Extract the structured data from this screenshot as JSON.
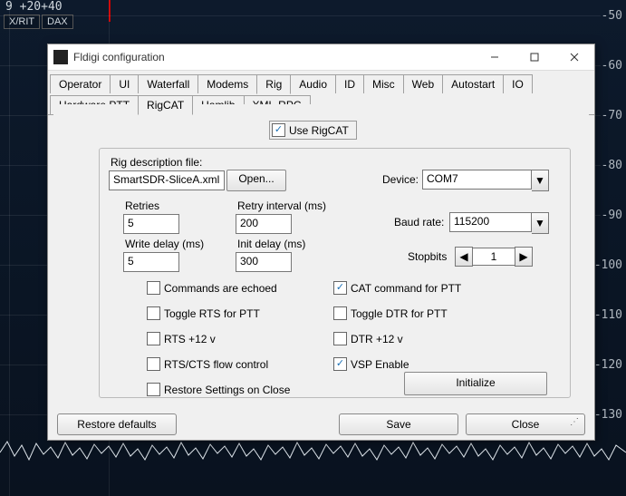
{
  "bg": {
    "top_scale": "9 +20+40",
    "top_buttons": [
      "X/RIT",
      "DAX"
    ],
    "db_labels": [
      "-50",
      "-60",
      "-70",
      "-80",
      "-90",
      "-100",
      "-110",
      "-120",
      "-130"
    ]
  },
  "win": {
    "title": "Fldigi configuration",
    "tabs_row1": [
      "Operator",
      "UI",
      "Waterfall",
      "Modems",
      "Rig",
      "Audio",
      "ID",
      "Misc",
      "Web",
      "Autostart",
      "IO"
    ],
    "tabs_row1_active": 4,
    "tabs_row2": [
      "Hardware PTT",
      "RigCAT",
      "Hamlib",
      "XML-RPC"
    ],
    "tabs_row2_active": 1,
    "use_rigcat": "Use RigCAT",
    "labels": {
      "rig_desc": "Rig description file:",
      "open": "Open...",
      "device": "Device:",
      "retries": "Retries",
      "retry_interval": "Retry interval (ms)",
      "baud": "Baud rate:",
      "write_delay": "Write delay (ms)",
      "init_delay": "Init delay (ms)",
      "stopbits": "Stopbits"
    },
    "values": {
      "rig_file": "SmartSDR-SliceA.xml",
      "device": "COM7",
      "retries": "5",
      "retry_interval": "200",
      "baud": "115200",
      "write_delay": "5",
      "init_delay": "300",
      "stopbits": "1"
    },
    "opts_left": [
      {
        "label": "Commands are echoed",
        "checked": false
      },
      {
        "label": "Toggle RTS for PTT",
        "checked": false
      },
      {
        "label": "RTS +12 v",
        "checked": false
      },
      {
        "label": "RTS/CTS flow control",
        "checked": false
      },
      {
        "label": "Restore Settings on Close",
        "checked": false
      }
    ],
    "opts_right": [
      {
        "label": "CAT command for PTT",
        "checked": true
      },
      {
        "label": "Toggle DTR for PTT",
        "checked": false
      },
      {
        "label": "DTR +12 v",
        "checked": false
      },
      {
        "label": "VSP Enable",
        "checked": true
      }
    ],
    "initialize": "Initialize",
    "bottom": {
      "restore": "Restore defaults",
      "save": "Save",
      "close": "Close"
    }
  }
}
